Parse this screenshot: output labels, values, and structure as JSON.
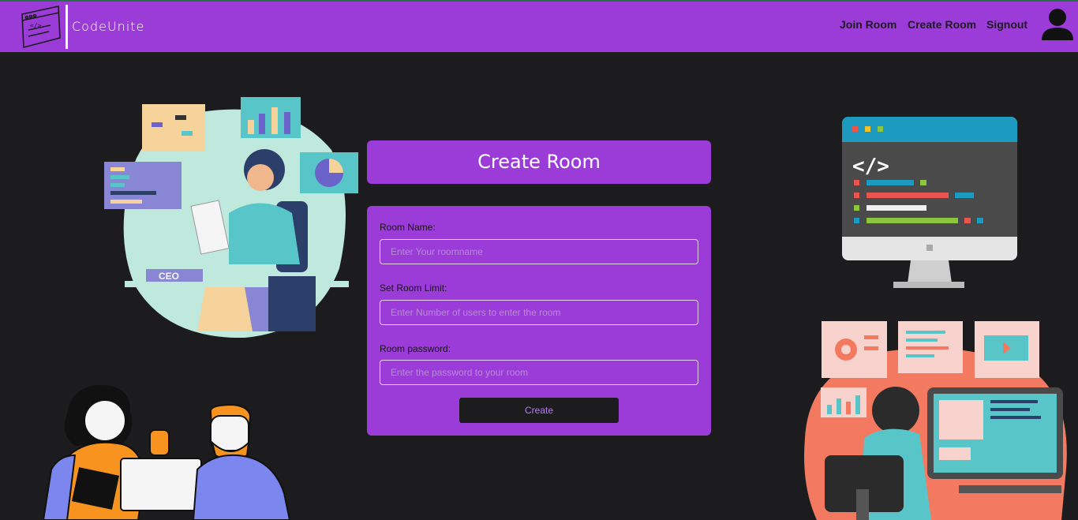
{
  "navbar": {
    "brand": "CodeUnite",
    "links": [
      "Join Room",
      "Create Room",
      "Signout"
    ],
    "avatar_icon": "user-icon",
    "background": "#9b3cd9"
  },
  "page": {
    "title": "Create Room"
  },
  "form": {
    "room_name": {
      "label": "Room Name:",
      "placeholder": "Enter Your roomname"
    },
    "room_limit": {
      "label": "Set Room Limit:",
      "placeholder": "Enter Number of users to enter the room"
    },
    "room_password": {
      "label": "Room password:",
      "placeholder": "Enter the password to your room"
    },
    "submit_label": "Create"
  },
  "illustrations": {
    "ceo_badge": "CEO",
    "code_glyph": "</>",
    "logo_glyph": "</>"
  }
}
